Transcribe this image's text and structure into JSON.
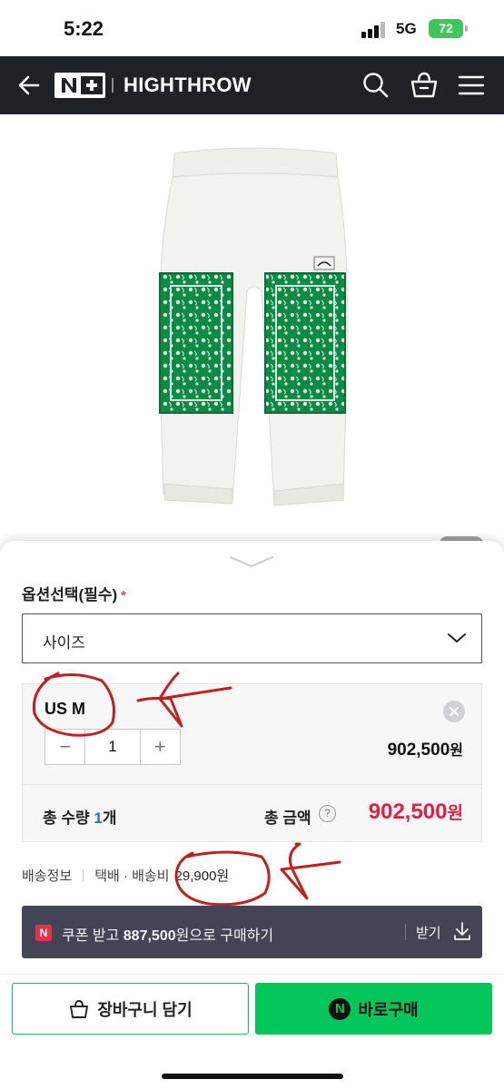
{
  "status_bar": {
    "time": "5:22",
    "network": "5G",
    "battery": "72"
  },
  "header": {
    "back_icon": "arrow-left-icon",
    "brand_logo": "N+",
    "store_name": "HIGHTHROW",
    "icons": [
      "search-icon",
      "shopping-bag-icon",
      "menu-icon"
    ]
  },
  "product": {
    "image": "white-sweatpants-green-bandana-panels",
    "accent_color": "#0f8a45"
  },
  "options": {
    "label": "옵션선택(필수)",
    "required_mark": "*",
    "size_select": {
      "label": "사이즈",
      "icon": "chevron-down-icon"
    }
  },
  "selected_item": {
    "name": "US M",
    "quantity": "1",
    "minus": "−",
    "plus": "+",
    "price": "902,500",
    "price_unit": "원",
    "remove_icon": "close-circle-icon"
  },
  "totals": {
    "qty_prefix": "총 수량 ",
    "qty_num": "1",
    "qty_suffix": "개",
    "amount_label": "총 금액",
    "help": "?",
    "amount": "902,500",
    "amount_unit": "원"
  },
  "shipping": {
    "label": "배송정보",
    "method": "택배 · 배송비",
    "fee": "29,900원"
  },
  "coupon": {
    "badge": "N",
    "text_pre": "쿠폰 받고 ",
    "text_amount": "887,500",
    "text_post": "원으로 구매하기",
    "download_label": "받기",
    "download_icon": "download-icon"
  },
  "actions": {
    "cart_label": "장바구니 담기",
    "cart_icon": "shopping-bag-icon",
    "buy_label": "바로구매",
    "buy_icon": "N",
    "primary_color": "#03c75a"
  },
  "annotation_color": "#c0201e"
}
